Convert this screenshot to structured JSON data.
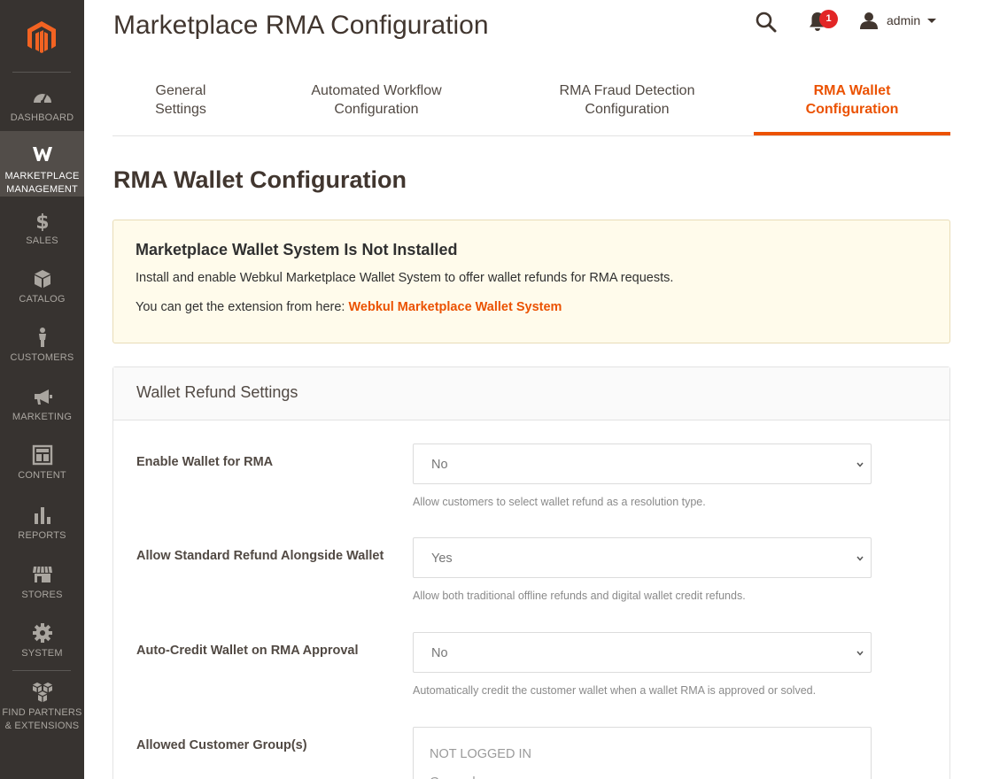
{
  "sidebar": {
    "items": [
      {
        "label": "DASHBOARD",
        "icon": "dashboard-icon"
      },
      {
        "label": "MARKETPLACE MANAGEMENT",
        "line1": "MARKETPLACE",
        "line2": "MANAGEMENT",
        "icon": "webkul-icon"
      },
      {
        "label": "SALES",
        "icon": "dollar-icon"
      },
      {
        "label": "CATALOG",
        "icon": "cube-icon"
      },
      {
        "label": "CUSTOMERS",
        "icon": "person-icon"
      },
      {
        "label": "MARKETING",
        "icon": "megaphone-icon"
      },
      {
        "label": "CONTENT",
        "icon": "layout-icon"
      },
      {
        "label": "REPORTS",
        "icon": "bar-chart-icon"
      },
      {
        "label": "STORES",
        "icon": "storefront-icon"
      },
      {
        "label": "SYSTEM",
        "icon": "gear-icon"
      },
      {
        "label": "FIND PARTNERS & EXTENSIONS",
        "line1": "FIND PARTNERS",
        "line2": "& EXTENSIONS",
        "icon": "boxes-icon"
      }
    ]
  },
  "header": {
    "title": "Marketplace RMA Configuration",
    "notification_count": "1",
    "user": "admin"
  },
  "tabs": [
    {
      "line1": "General",
      "line2": "Settings"
    },
    {
      "line1": "Automated Workflow",
      "line2": "Configuration"
    },
    {
      "line1": "RMA Fraud Detection",
      "line2": "Configuration"
    },
    {
      "line1": "RMA Wallet",
      "line2": "Configuration"
    }
  ],
  "section_title": "RMA Wallet Configuration",
  "notice": {
    "title": "Marketplace Wallet System Is Not Installed",
    "body": "Install and enable Webkul Marketplace Wallet System to offer wallet refunds for RMA requests.",
    "link_prefix": "You can get the extension from here: ",
    "link_text": "Webkul Marketplace Wallet System"
  },
  "settings": {
    "card_title": "Wallet Refund Settings",
    "fields": [
      {
        "label": "Enable Wallet for RMA",
        "value": "No",
        "hint": "Allow customers to select wallet refund as a resolution type."
      },
      {
        "label": "Allow Standard Refund Alongside Wallet",
        "value": "Yes",
        "hint": "Allow both traditional offline refunds and digital wallet credit refunds."
      },
      {
        "label": "Auto-Credit Wallet on RMA Approval",
        "value": "No",
        "hint": "Automatically credit the customer wallet when a wallet RMA is approved or solved."
      }
    ],
    "customer_groups": {
      "label": "Allowed Customer Group(s)",
      "options": [
        "NOT LOGGED IN",
        "General"
      ]
    }
  },
  "colors": {
    "accent": "#eb5202",
    "sidebar_bg": "#373330",
    "notice_bg": "#fffbeb",
    "badge": "#e22626"
  }
}
